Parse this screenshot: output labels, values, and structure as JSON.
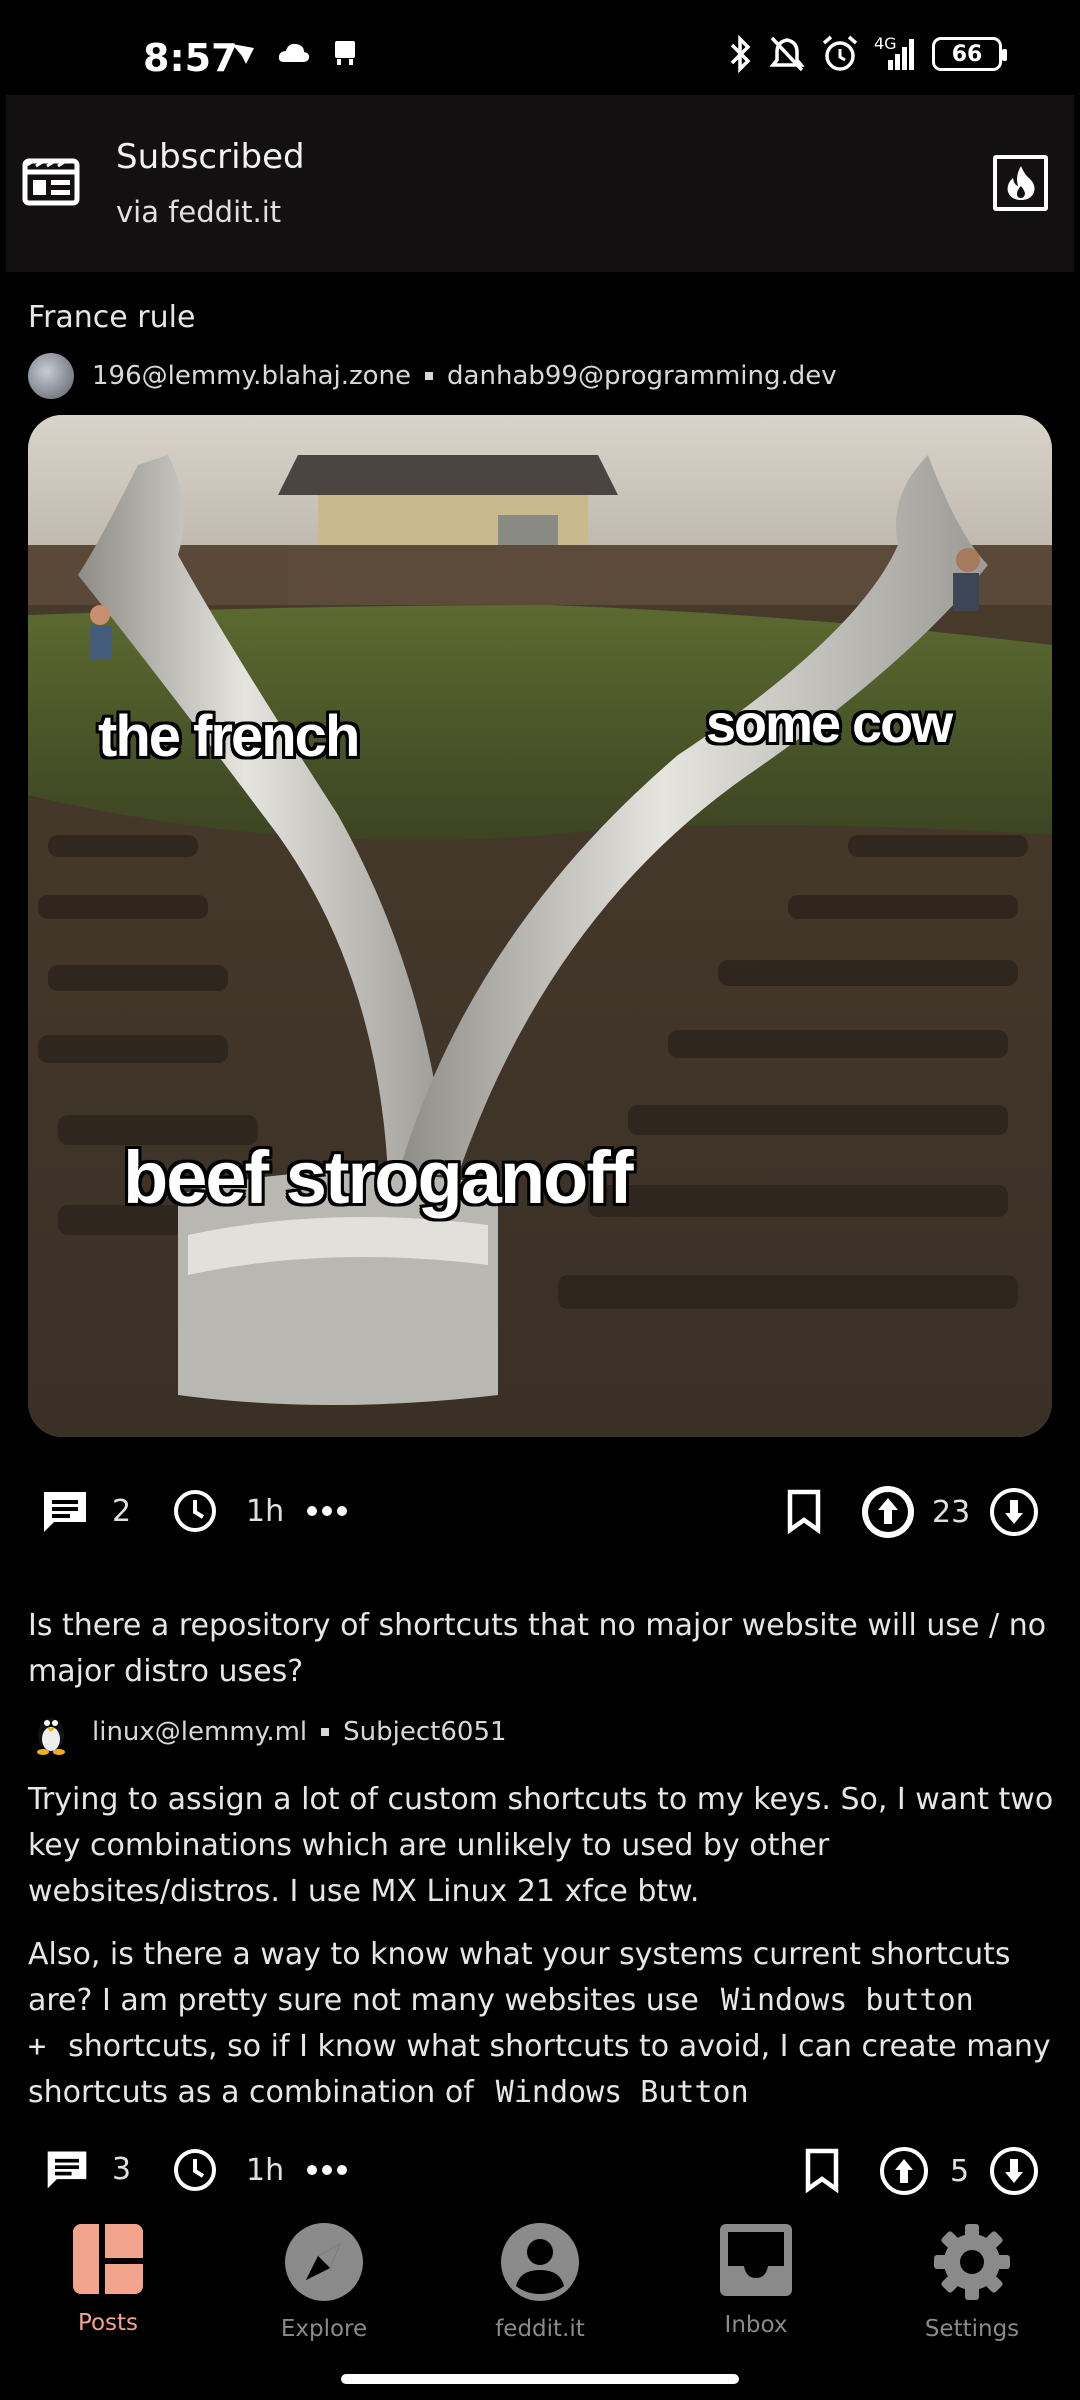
{
  "status_bar": {
    "time": "8:57",
    "network": "4G",
    "battery": "66"
  },
  "header": {
    "title": "Subscribed",
    "subtitle": "via feddit.it"
  },
  "posts": [
    {
      "title": "France rule",
      "community": "196@lemmy.blahaj.zone",
      "author": "danhab99@programming.dev",
      "image_labels": [
        "the french",
        "some cow",
        "beef stroganoff"
      ],
      "comments": "2",
      "age": "1h",
      "score": "23"
    },
    {
      "title": "Is there a repository of shortcuts that no major website will use / no major distro uses?",
      "community": "linux@lemmy.ml",
      "author": "Subject6051",
      "body_p1": "Trying to assign a lot of custom shortcuts to my keys. So, I want two key combinations which are unlikely to used by other websites/distros. I use MX Linux 21 xfce btw.",
      "body_p2_a": "Also, is there a way to know what your systems current shortcuts are? I am pretty sure not many websites use",
      "body_p2_code1": "Windows button +",
      "body_p2_b": "shortcuts, so if I know what shortcuts to avoid, I can create many shortcuts as a combination of",
      "body_p2_code2": "Windows Button",
      "comments": "3",
      "age": "1h",
      "score": "5"
    }
  ],
  "nav": {
    "items": [
      {
        "label": "Posts",
        "icon": "posts-icon"
      },
      {
        "label": "Explore",
        "icon": "compass-icon"
      },
      {
        "label": "feddit.it",
        "icon": "account-icon"
      },
      {
        "label": "Inbox",
        "icon": "inbox-icon"
      },
      {
        "label": "Settings",
        "icon": "gear-icon"
      }
    ],
    "active_color": "#f2a58c",
    "inactive_color": "#8a8a8a"
  }
}
